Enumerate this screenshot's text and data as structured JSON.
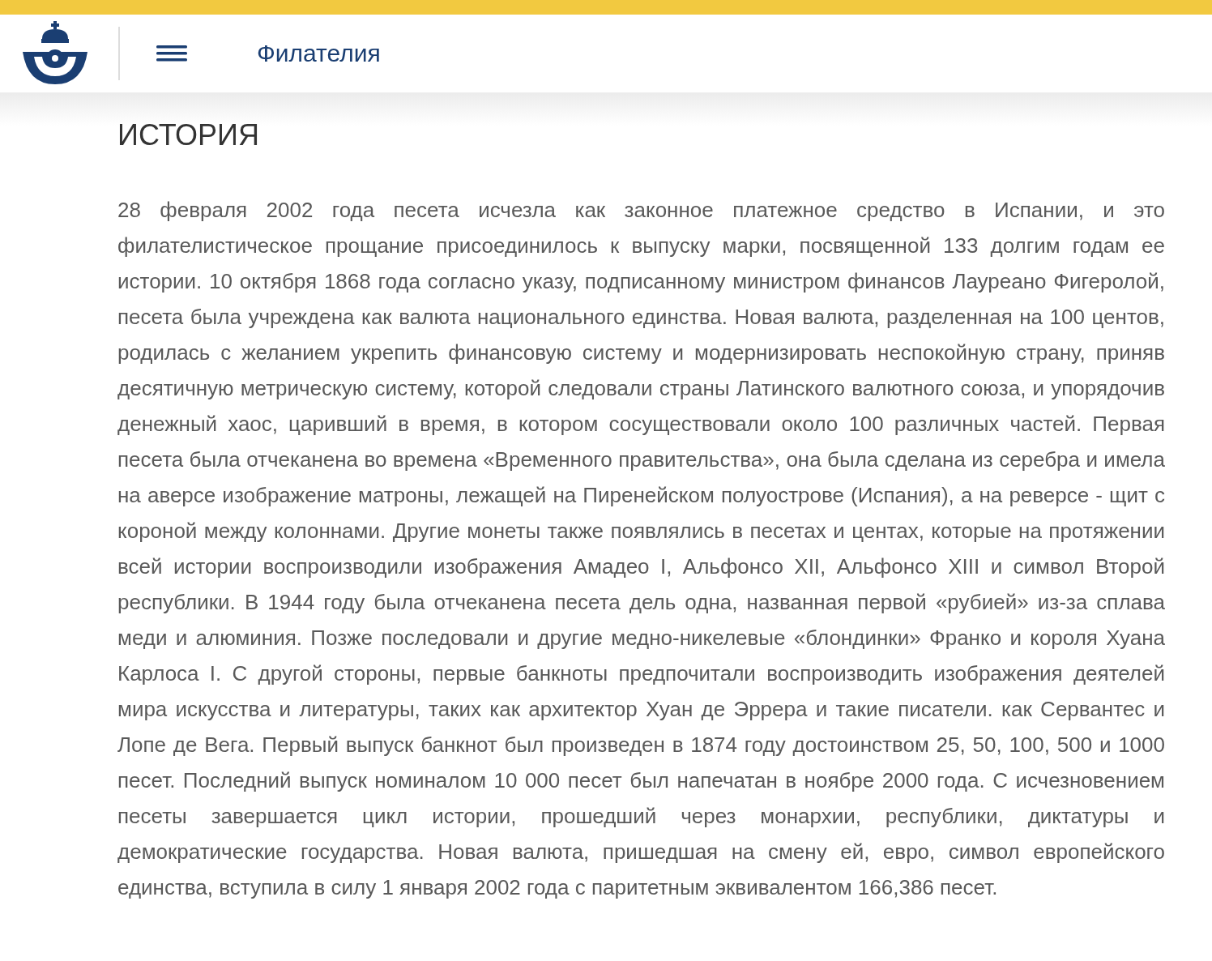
{
  "header": {
    "title": "Филателия"
  },
  "article": {
    "heading": "ИСТОРИЯ",
    "paragraph": "28 февраля 2002 года песета исчезла как законное платежное средство в Испании, и это филателистическое прощание присоединилось к выпуску марки, посвященной 133 долгим годам ее истории. 10 октября 1868 года согласно указу, подписанному министром финансов Лауреано Фигеролой, песета была учреждена как валюта национального единства. Новая валюта, разделенная на 100 центов, родилась с желанием укрепить финансовую систему и модернизировать неспокойную страну, приняв десятичную метрическую систему, которой следовали страны Латинского валютного союза, и упорядочив денежный хаос, царивший в время, в котором сосуществовали около 100 различных частей. Первая песета была отчеканена во времена «Временного правительства», она была сделана из серебра и имела на аверсе изображение матроны, лежащей на Пиренейском полуострове (Испания), а на реверсе - щит с короной между колоннами. Другие монеты также появлялись в песетах и центах, которые на протяжении всей истории воспроизводили изображения Амадео I, Альфонсо XII, Альфонсо XIII и символ Второй республики. В 1944 году была отчеканена песета дель одна, названная первой «рубией» из-за сплава меди и алюминия. Позже последовали и другие медно-никелевые «блондинки» Франко и короля Хуана Карлоса I. С другой стороны, первые банкноты предпочитали воспроизводить изображения деятелей мира искусства и литературы, таких как архитектор Хуан де Эррера и такие писатели. как Сервантес и Лопе де Вега. Первый выпуск банкнот был произведен в 1874 году достоинством 25, 50, 100, 500 и 1000 песет. Последний выпуск номиналом 10 000 песет был напечатан в ноябре 2000 года. С исчезновением песеты завершается цикл истории, прошедший через монархии, республики, диктатуры и демократические государства. Новая валюта, пришедшая на смену ей, евро, символ европейского единства, вступила в силу 1 января 2002 года с паритетным эквивалентом 166,386 песет."
  }
}
